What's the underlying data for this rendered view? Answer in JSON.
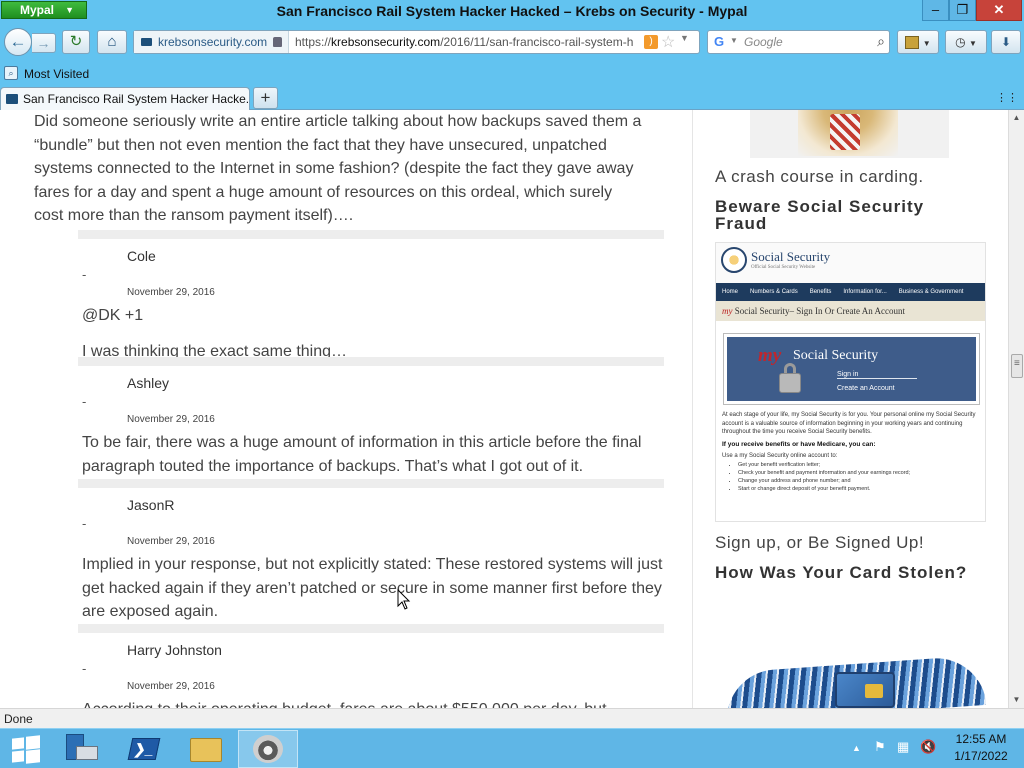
{
  "window": {
    "app_button": "Mypal",
    "title": "San Francisco Rail System Hacker Hacked – Krebs on Security - Mypal",
    "minimize_glyph": "–",
    "maximize_glyph": "❐",
    "close_glyph": "✕"
  },
  "nav": {
    "site_identity": "krebsonsecurity.com",
    "url_prefix": "https://",
    "url_host": "krebsonsecurity.com",
    "url_path": "/2016/11/san-francisco-rail-system-h",
    "search_engine": "G",
    "search_placeholder": "Google"
  },
  "bookmarks": {
    "most_visited": "Most Visited"
  },
  "tabs": [
    {
      "label": "San Francisco Rail System Hacker Hacke...",
      "active": true
    }
  ],
  "article": {
    "lead_text": "Did someone seriously write an entire article talking about how backups saved them a “bundle” but then not even mention the fact that they have unsecured, unpatched systems connected to the Internet in some fashion? (despite the fact they gave away fares for a day and spent a huge amount of resources on this ordeal, which surely cost more than the ransom payment itself)…."
  },
  "comments": [
    {
      "author": "Cole",
      "dash": "-",
      "date": "November 29, 2016",
      "paragraphs": [
        "@DK +1",
        "I was thinking the exact same thing…"
      ]
    },
    {
      "author": "Ashley",
      "dash": "-",
      "date": "November 29, 2016",
      "paragraphs": [
        "To be fair, there was a huge amount of information in this article before the final paragraph touted the importance of backups. That’s what I got out of it."
      ]
    },
    {
      "author": "JasonR",
      "dash": "-",
      "date": "November 29, 2016",
      "paragraphs": [
        "Implied in your response, but not explicitly stated: These restored systems will just get hacked again if they aren’t patched or secure in some manner first before they are exposed again."
      ]
    },
    {
      "author": "Harry Johnston",
      "dash": "-",
      "date": "November 29, 2016",
      "paragraphs": [
        "According to their operating budget, fares are about $550,000 per day, but"
      ]
    }
  ],
  "sidebar": {
    "caption_1": "A crash course in carding.",
    "heading_1": "Beware Social Security Fraud",
    "caption_2": "Sign up, or Be Signed Up!",
    "heading_2": "How Was Your Card Stolen?",
    "ss_ad": {
      "site_title": "Social Security",
      "site_subtitle": "Official Social Security Website",
      "nav_items": [
        "Home",
        "Numbers & Cards",
        "Benefits",
        "Information for...",
        "Business & Government"
      ],
      "signbar_my": "my",
      "signbar_text": "Social Security– Sign In Or Create An Account",
      "panel_my": "my",
      "panel_brand": "Social Security",
      "sign_in": "Sign in",
      "create_account": "Create an Account",
      "intro": "At each stage of your life, my Social Security is for you. Your personal online my Social Security account is a valuable source of information beginning in your working years and continuing throughout the time you receive Social Security benefits.",
      "medicare_heading": "If you receive benefits or have Medicare, you can:",
      "use_line": "Use a my Social Security online account to:",
      "bullets": [
        "Get your benefit verification letter;",
        "Check your benefit and payment information and your earnings record;",
        "Change your address and phone number; and",
        "Start or change direct deposit of your benefit payment."
      ]
    }
  },
  "status": {
    "text": "Done"
  },
  "taskbar": {
    "time": "12:55 AM",
    "date": "1/17/2022"
  },
  "colors": {
    "window_chrome": "#62c3f0",
    "taskbar": "#5fb6e6",
    "close_button": "#c7433a",
    "ss_navy": "#1e3b5e",
    "ss_panel": "#3e5c8a"
  }
}
